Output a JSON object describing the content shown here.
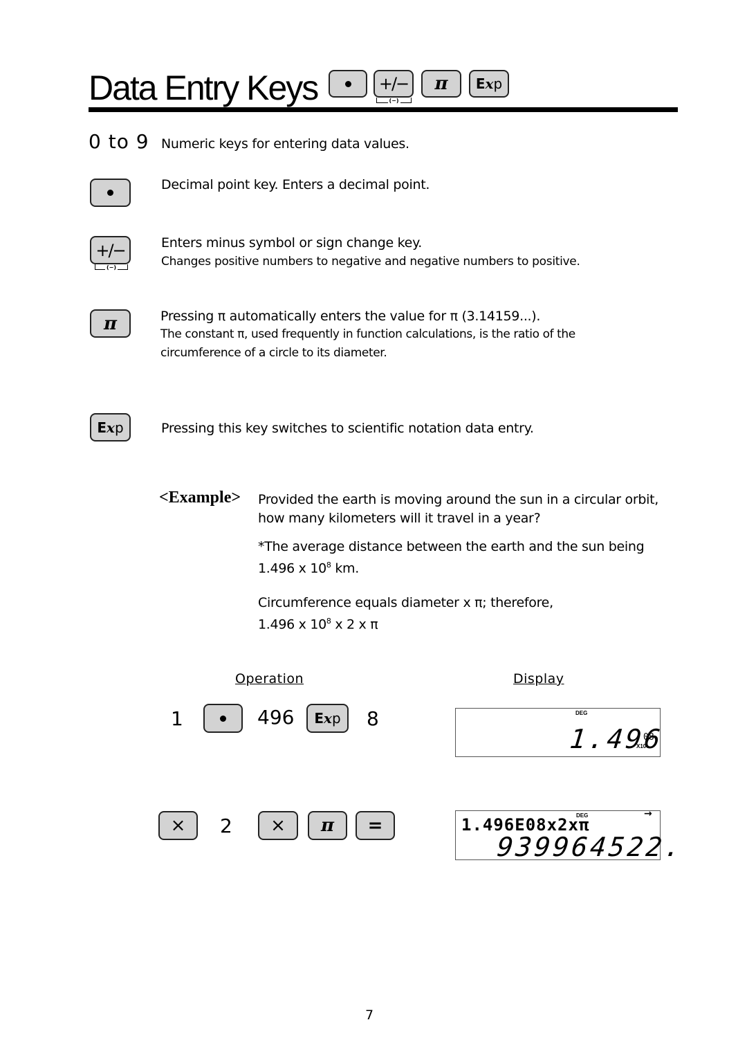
{
  "header": {
    "title": "Data Entry Keys",
    "title_keys": [
      {
        "name": "decimal-point",
        "icon": "dot-icon"
      },
      {
        "name": "sign-change",
        "label": "+/−",
        "sublabel": "(−)"
      },
      {
        "name": "pi",
        "label": "π"
      },
      {
        "name": "exp",
        "label_bold": "E",
        "label_italic": "x",
        "label_rest": "p"
      }
    ]
  },
  "entries": {
    "numeric": {
      "label": "0 to 9",
      "text": "Numeric keys for entering data values."
    },
    "decimal": {
      "text": "Decimal point key. Enters a decimal point."
    },
    "sign": {
      "text": "Enters minus symbol or sign change key.",
      "subtext": "Changes positive numbers to negative and negative numbers to positive.",
      "key_label": "+/−",
      "key_sublabel": "(−)"
    },
    "pi": {
      "key_label": "π",
      "text": "Pressing π automatically enters the value for π (3.14159...).",
      "subtext_1": "The constant π, used frequently in function calculations, is the ratio of the",
      "subtext_2": "circumference of a circle to its diameter."
    },
    "exp": {
      "key_bold": "E",
      "key_italic": "x",
      "key_rest": "p",
      "text": "Pressing this key switches to scientific notation data entry."
    }
  },
  "example": {
    "label": "<Example>",
    "question_1": "Provided the earth is moving around the sun in a circular orbit,",
    "question_2": "how many kilometers will it travel in a year?",
    "note_1": "*The average distance between the earth and the sun being",
    "note_2_pre": "1.496 x 10",
    "note_2_sup": "8",
    "note_2_post": " km.",
    "formula_1": "Circumference equals diameter x π; therefore,",
    "formula_2_pre": "1.496 x 10",
    "formula_2_sup": "8",
    "formula_2_post": " x 2 x π",
    "col_operation": "Operation",
    "col_display": "Display",
    "step1": {
      "num1": "1",
      "num2": "496",
      "num3": "8",
      "display_indicator": "DEG",
      "display_value": "1.496",
      "display_exponent": "08",
      "display_x10": "X10"
    },
    "step2": {
      "key_times": "×",
      "num": "2",
      "key_pi": "π",
      "key_equals": "=",
      "display_indicator": "DEG",
      "display_arrow": "→",
      "display_expression": "1.496E08x2xπ",
      "display_result": "939964522."
    }
  },
  "footer": {
    "page_number": "7"
  }
}
